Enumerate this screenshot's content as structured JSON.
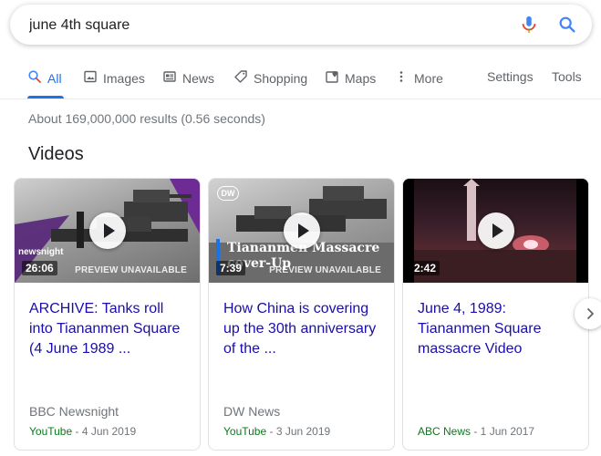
{
  "search": {
    "query": "june 4th square"
  },
  "tabs": [
    {
      "label": "All",
      "icon": "search-icon"
    },
    {
      "label": "Images",
      "icon": "image-icon"
    },
    {
      "label": "News",
      "icon": "newspaper-icon"
    },
    {
      "label": "Shopping",
      "icon": "tag-icon"
    },
    {
      "label": "Maps",
      "icon": "map-pin-icon"
    },
    {
      "label": "More",
      "icon": "kebab-icon"
    }
  ],
  "tools": {
    "settings": "Settings",
    "tools": "Tools"
  },
  "stats": "About 169,000,000 results (0.56 seconds)",
  "section_title": "Videos",
  "videos": [
    {
      "title": "ARCHIVE: Tanks roll into Tiananmen Square (4 June 1989 ...",
      "duration": "26:06",
      "preview": "PREVIEW UNAVAILABLE",
      "overlay": "newsnight",
      "channel": "BBC Newsnight",
      "source": "YouTube",
      "date": " - 4 Jun 2019"
    },
    {
      "title": "How China is covering up the 30th anniversary of the ...",
      "duration": "7:39",
      "preview": "PREVIEW UNAVAILABLE",
      "overlay_brand": "DW",
      "overlay": "Tiananmen Massacre cover-Up",
      "channel": "DW News",
      "source": "YouTube",
      "date": " - 3 Jun 2019"
    },
    {
      "title": "June 4, 1989: Tiananmen Square massacre Video",
      "duration": "2:42",
      "channel": "",
      "source": "ABC News",
      "date": " - 1 Jun 2017"
    }
  ],
  "colors": {
    "link": "#1a0dab",
    "accent": "#1a73e8",
    "source": "#0b7a1b"
  }
}
